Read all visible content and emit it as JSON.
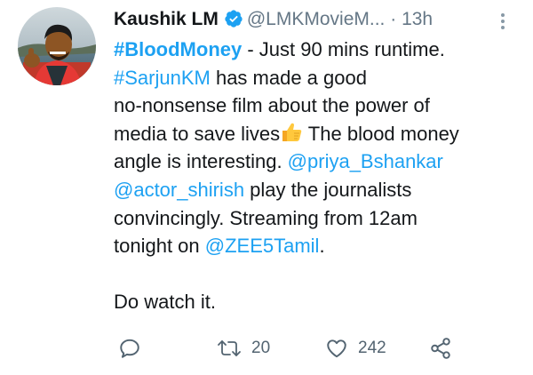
{
  "user": {
    "name": "Kaushik LM",
    "handle": "@LMKMovieM...",
    "separator": "·",
    "time": "13h"
  },
  "tweet": {
    "line1_hashtag": "#BloodMoney",
    "line1_text": " - Just 90 mins runtime.",
    "line2_hashtag": "#SarjunKM",
    "line2_text": " has made a good",
    "line3_text": "no-nonsense film about the power of",
    "line4_text": "media to save lives",
    "line4_after": " The blood money",
    "line5_text": "angle is interesting. ",
    "mention1": "@priya_Bshankar",
    "mention2": "@actor_shirish",
    "line6_text": " play the journalists",
    "line7_text": "convincingly. Streaming from 12am",
    "line8_text": "tonight on ",
    "mention3": "@ZEE5Tamil",
    "line8_end": ".",
    "closing": "Do watch it."
  },
  "actions": {
    "retweets": "20",
    "likes": "242"
  },
  "icons": {
    "verified": "verified-badge-icon",
    "more": "more-vertical-icon",
    "reply": "reply-icon",
    "retweet": "retweet-icon",
    "like": "heart-icon",
    "share": "share-icon",
    "emoji": "thumbs-up-emoji"
  },
  "colors": {
    "link": "#1da1f2",
    "muted": "#657786",
    "text": "#14171a"
  }
}
